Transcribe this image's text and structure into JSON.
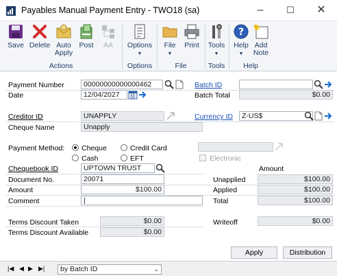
{
  "window": {
    "title": "Payables Manual Payment Entry  -  TWO18 (sa)"
  },
  "ribbon": {
    "actions": {
      "save": "Save",
      "delete": "Delete",
      "auto_apply_1": "Auto",
      "auto_apply_2": "Apply",
      "post": "Post",
      "aa": "AA",
      "group": "Actions"
    },
    "options": {
      "options": "Options",
      "group": "Options"
    },
    "file": {
      "file": "File",
      "print": "Print",
      "group": "File"
    },
    "tools": {
      "tools": "Tools",
      "group": "Tools"
    },
    "help": {
      "help": "Help",
      "add_note_1": "Add",
      "add_note_2": "Note",
      "group": "Help"
    }
  },
  "form": {
    "payment_number": {
      "label": "Payment Number",
      "value": "00000000000000462"
    },
    "date": {
      "label": "Date",
      "value": "12/04/2027"
    },
    "batch_id": {
      "label": "Batch ID",
      "value": ""
    },
    "batch_total": {
      "label": "Batch Total",
      "value": "$0.00"
    },
    "creditor_id": {
      "label": "Creditor ID",
      "value": "UNAPPLY"
    },
    "cheque_name": {
      "label": "Cheque Name",
      "value": "Unapply"
    },
    "currency_id": {
      "label": "Currency ID",
      "value": "Z-US$"
    },
    "payment_method": {
      "label": "Payment Method:",
      "options": {
        "cheque": "Cheque",
        "credit_card": "Credit Card",
        "cash": "Cash",
        "eft": "EFT"
      },
      "selected": "Cheque",
      "electronic": "Electronic"
    },
    "chequebook_id": {
      "label": "Chequebook ID",
      "value": "UPTOWN TRUST"
    },
    "document_no": {
      "label": "Document No.",
      "value": "20071"
    },
    "amount": {
      "label": "Amount",
      "value": "$100.00"
    },
    "comment": {
      "label": "Comment",
      "value": "|"
    },
    "amount_header": "Amount",
    "unapplied": {
      "label": "Unapplied",
      "value": "$100.00"
    },
    "applied": {
      "label": "Applied",
      "value": "$100.00"
    },
    "total": {
      "label": "Total",
      "value": "$100.00"
    },
    "terms_discount_taken": {
      "label": "Terms Discount Taken",
      "value": "$0.00"
    },
    "terms_discount_available": {
      "label": "Terms Discount Available",
      "value": "$0.00"
    },
    "writeoff": {
      "label": "Writeoff",
      "value": "$0.00"
    }
  },
  "buttons": {
    "apply": "Apply",
    "distribution": "Distribution"
  },
  "statusbar": {
    "sort": "by Batch ID"
  },
  "colors": {
    "link": "#1a4fb5",
    "ribbon_text": "#1f3b66",
    "readonly_bg": "#e9ebee"
  }
}
